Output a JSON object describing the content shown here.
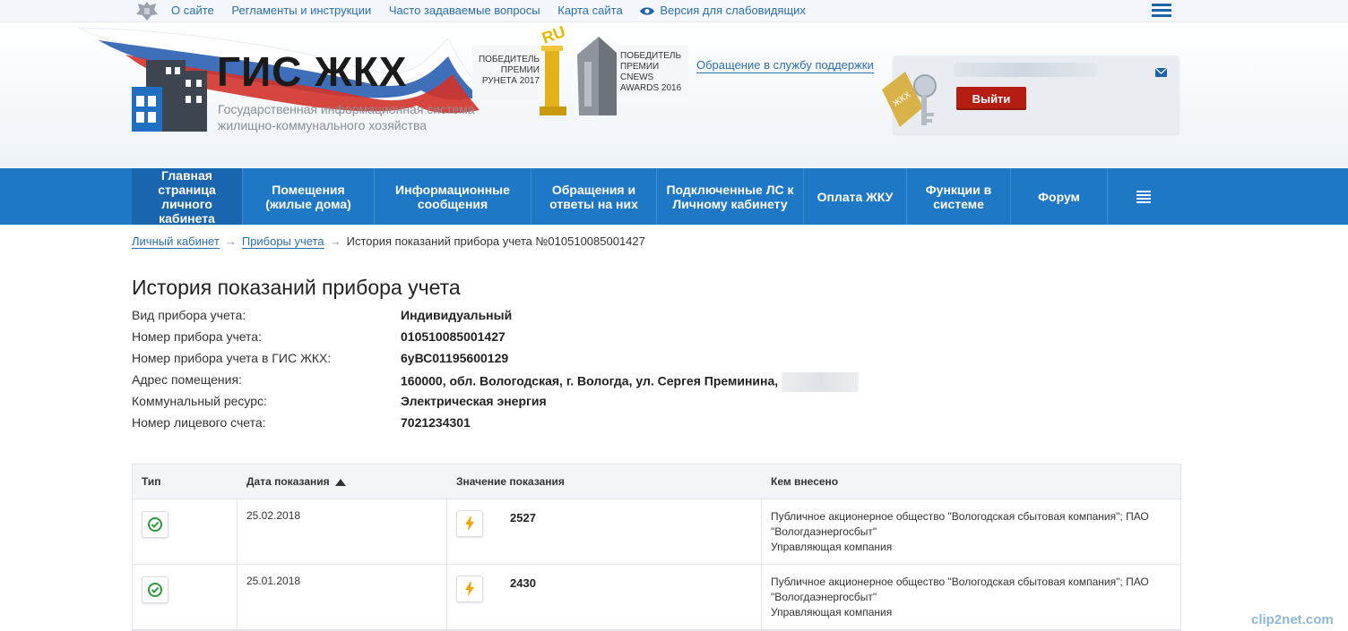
{
  "topbar": {
    "links": [
      "О сайте",
      "Регламенты и инструкции",
      "Часто задаваемые вопросы",
      "Карта сайта"
    ],
    "accessibility": "Версия для слабовидящих"
  },
  "header": {
    "logo_title": "ГИС ЖКХ",
    "logo_subtitle": "Государственная информационная система жилищно-коммунального хозяйства",
    "award1": "ПОБЕДИТЕЛЬ ПРЕМИИ РУНЕТА 2017",
    "award2": "ПОБЕДИТЕЛЬ ПРЕМИИ CNEWS AWARDS 2016",
    "trophy_badge": "RU",
    "support_link": "Обращение в службу поддержки",
    "logout": "Выйти"
  },
  "nav": {
    "items": [
      "Главная страница личного кабинета",
      "Помещения (жилые дома)",
      "Информационные сообщения",
      "Обращения и ответы на них",
      "Подключенные ЛС к Личному кабинету",
      "Оплата ЖКУ",
      "Функции в системе",
      "Форум"
    ]
  },
  "breadcrumb": {
    "items": [
      "Личный кабинет",
      "Приборы учета",
      "История показаний прибора учета №010510085001427"
    ],
    "sep": "→"
  },
  "page": {
    "title": "История показаний прибора учета",
    "meta": [
      {
        "label": "Вид прибора учета:",
        "value": "Индивидуальный"
      },
      {
        "label": "Номер прибора учета:",
        "value": "010510085001427"
      },
      {
        "label": "Номер прибора учета в ГИС ЖКХ:",
        "value": "6уВС01195600129"
      },
      {
        "label": "Адрес помещения:",
        "value": "160000, обл. Вологодская, г. Вологда, ул. Сергея Преминина,"
      },
      {
        "label": "Коммунальный ресурс:",
        "value": "Электрическая энергия"
      },
      {
        "label": "Номер лицевого счета:",
        "value": "7021234301"
      }
    ]
  },
  "table": {
    "headers": [
      "Тип",
      "Дата показания",
      "Значение показания",
      "Кем внесено"
    ],
    "rows": [
      {
        "date": "25.02.2018",
        "value": "2527",
        "who": "Публичное акционерное общество \"Вологодская сбытовая компания\"; ПАО \"Вологдаэнергосбыт\"",
        "role": "Управляющая компания"
      },
      {
        "date": "25.01.2018",
        "value": "2430",
        "who": "Публичное акционерное общество \"Вологодская сбытовая компания\"; ПАО \"Вологдаэнергосбыт\"",
        "role": "Управляющая компания"
      }
    ]
  },
  "watermark": "clip2net.com",
  "colors": {
    "nav": "#1e78c6",
    "link": "#2a6fb0",
    "logout": "#b51d13",
    "status_ok": "#2a9a3a",
    "bolt": "#f0a800"
  }
}
